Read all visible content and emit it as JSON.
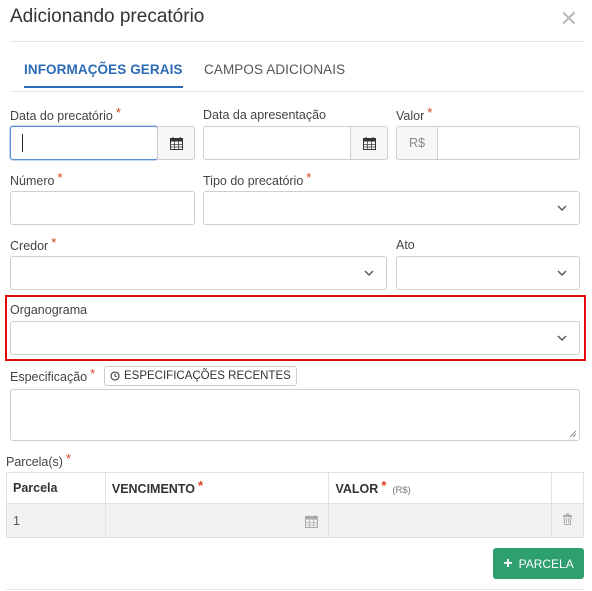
{
  "dialog": {
    "title": "Adicionando precatório"
  },
  "tabs": [
    {
      "label": "INFORMAÇÕES GERAIS",
      "active": true
    },
    {
      "label": "CAMPOS ADICIONAIS",
      "active": false
    }
  ],
  "fields": {
    "data_precatorio": {
      "label": "Data do precatório",
      "required": "*",
      "value": ""
    },
    "data_apresentacao": {
      "label": "Data da apresentação",
      "value": ""
    },
    "valor": {
      "label": "Valor",
      "required": "*",
      "currency": "R$",
      "value": ""
    },
    "numero": {
      "label": "Número",
      "required": "*",
      "value": ""
    },
    "tipo_precatorio": {
      "label": "Tipo do precatório",
      "required": "*",
      "value": ""
    },
    "credor": {
      "label": "Credor",
      "required": "*",
      "value": ""
    },
    "ato": {
      "label": "Ato",
      "value": ""
    },
    "organograma": {
      "label": "Organograma",
      "value": ""
    },
    "especificacao": {
      "label": "Especificação",
      "required": "*",
      "recentes_button": "ESPECIFICAÇÕES RECENTES",
      "value": ""
    }
  },
  "parcelas": {
    "label": "Parcela(s)",
    "required": "*",
    "columns": {
      "parcela": "Parcela",
      "vencimento": "VENCIMENTO",
      "valor": "VALOR",
      "valor_unit": "(R$)"
    },
    "rows": [
      {
        "parcela": "1",
        "vencimento": "",
        "valor": ""
      }
    ],
    "add_button": "PARCELA"
  },
  "colors": {
    "primary": "#2a6bb5",
    "success": "#2e9f6e",
    "required": "#d8401c",
    "highlight": "#e10b0b"
  }
}
